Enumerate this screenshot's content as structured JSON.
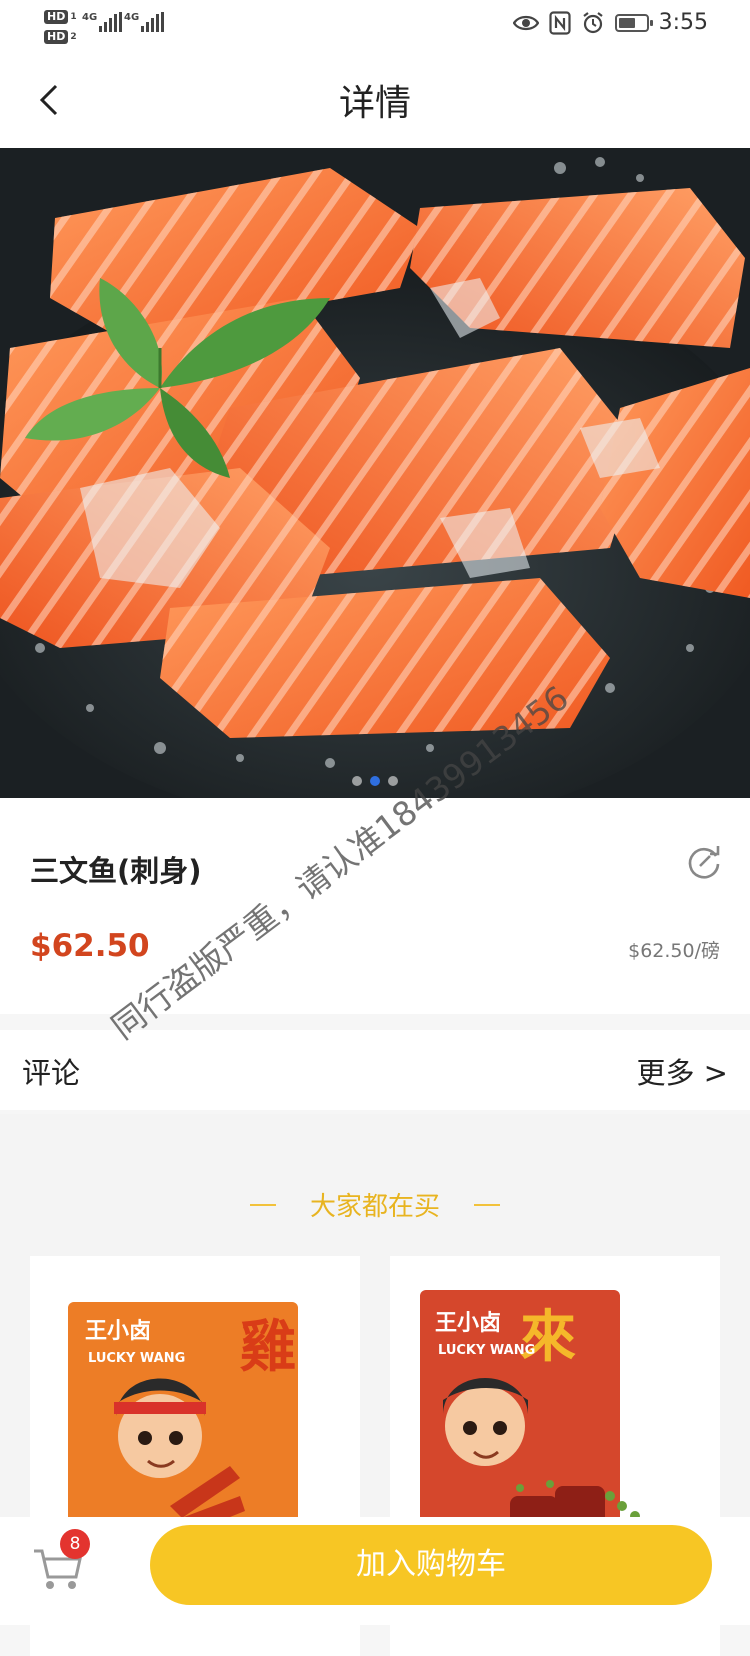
{
  "status_bar": {
    "sim1": "HD",
    "sim1_sub": "1",
    "sim2": "HD",
    "sim2_sub": "2",
    "network1": "4G",
    "network2": "4G",
    "time": "3:55",
    "battery_level": 0.6,
    "icons": [
      "eye-icon",
      "nfc-icon",
      "alarm-icon",
      "battery-icon"
    ]
  },
  "nav": {
    "title": "详情",
    "back_icon": "chevron-left-icon"
  },
  "hero": {
    "image": "salmon-sashimi-photo",
    "slide_count": 3,
    "active_slide": 2
  },
  "product": {
    "name": "三文鱼(刺身)",
    "price": "$62.50",
    "unit_price": "$62.50/磅",
    "share_icon": "share-icon"
  },
  "watermark": "同行盗版严重，请认准18439913456",
  "comments": {
    "title": "评论",
    "more": "更多 >"
  },
  "recommend": {
    "title": "大家都在买",
    "items": [
      {
        "brand": "王小卤",
        "brand_en": "LUCKY WANG",
        "side_text": "雞",
        "image": "braised-chicken-feet-package"
      },
      {
        "brand": "王小卤",
        "brand_en": "LUCKY WANG",
        "side_text": "來",
        "image": "braised-beef-package"
      }
    ]
  },
  "bottom": {
    "cart_count": "8",
    "add_to_cart": "加入购物车"
  },
  "colors": {
    "price": "#d2451e",
    "accent_yellow": "#f7c624",
    "badge_red": "#e3342f",
    "active_dot": "#2f6fe0"
  }
}
